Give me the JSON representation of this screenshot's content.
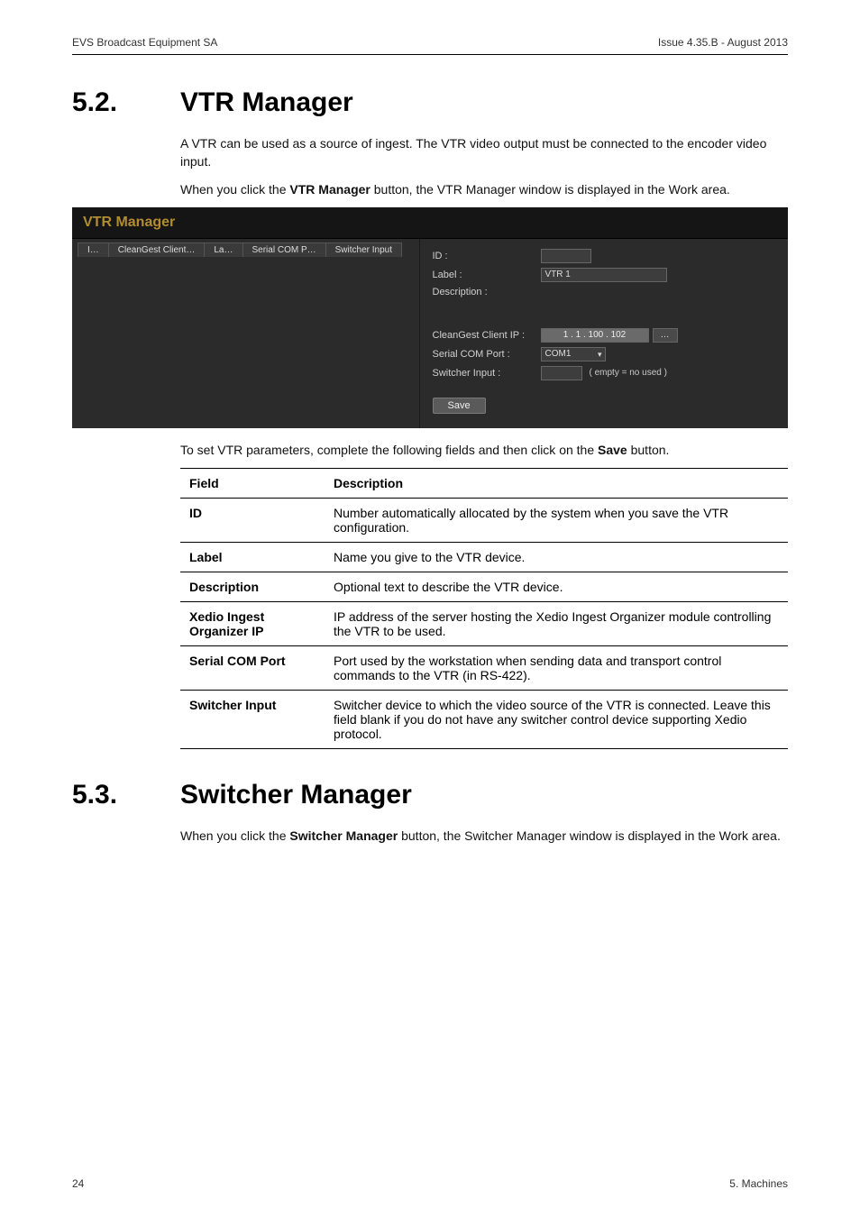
{
  "header": {
    "left": "EVS Broadcast Equipment SA",
    "right": "Issue 4.35.B - August 2013"
  },
  "section52": {
    "num": "5.2.",
    "title": "VTR Manager",
    "para1_a": "A VTR can be used as a source of ingest. The VTR video output must be connected to the encoder video input.",
    "para2_a": "When you click the ",
    "para2_b": "VTR Manager",
    "para2_c": " button, the VTR Manager window is displayed in the Work area."
  },
  "screenshot": {
    "title": "VTR Manager",
    "tabs": [
      "I…",
      "CleanGest Client…",
      "La…",
      "Serial COM P…",
      "Switcher Input"
    ],
    "labels": {
      "id": "ID :",
      "label": "Label :",
      "description": "Description :",
      "cg_client_ip": "CleanGest Client IP :",
      "serial_port": "Serial COM Port :",
      "switcher_input": "Switcher Input :"
    },
    "values": {
      "label_value": "VTR 1",
      "ip_value": "1   .   1   . 100 . 102",
      "ip_dots": "…",
      "com_port": "COM1",
      "switcher_hint": "( empty = no used )"
    },
    "save": "Save"
  },
  "caption_a": "To set VTR parameters, complete the following fields and then click on the ",
  "caption_b": "Save",
  "caption_c": " button.",
  "table": {
    "headers": {
      "field": "Field",
      "description": "Description"
    },
    "rows": [
      {
        "field": "ID",
        "desc": "Number automatically allocated by the system when you save the VTR configuration."
      },
      {
        "field": "Label",
        "desc": "Name you give to the VTR device."
      },
      {
        "field": "Description",
        "desc": "Optional text to describe the VTR device."
      },
      {
        "field": "Xedio Ingest Organizer IP",
        "desc": "IP address of the server hosting the Xedio Ingest Organizer module controlling the VTR to be used."
      },
      {
        "field": "Serial COM Port",
        "desc": "Port used by the workstation when sending data and transport control commands to the VTR (in RS-422)."
      },
      {
        "field": "Switcher Input",
        "desc": "Switcher device to which the video source of the VTR is connected. Leave this field blank if you do not have any switcher control device supporting Xedio protocol."
      }
    ]
  },
  "section53": {
    "num": "5.3.",
    "title": "Switcher Manager",
    "para_a": "When you click the ",
    "para_b": "Switcher Manager",
    "para_c": " button, the Switcher Manager window is displayed in the Work area."
  },
  "footer": {
    "left": "24",
    "right": "5. Machines"
  }
}
